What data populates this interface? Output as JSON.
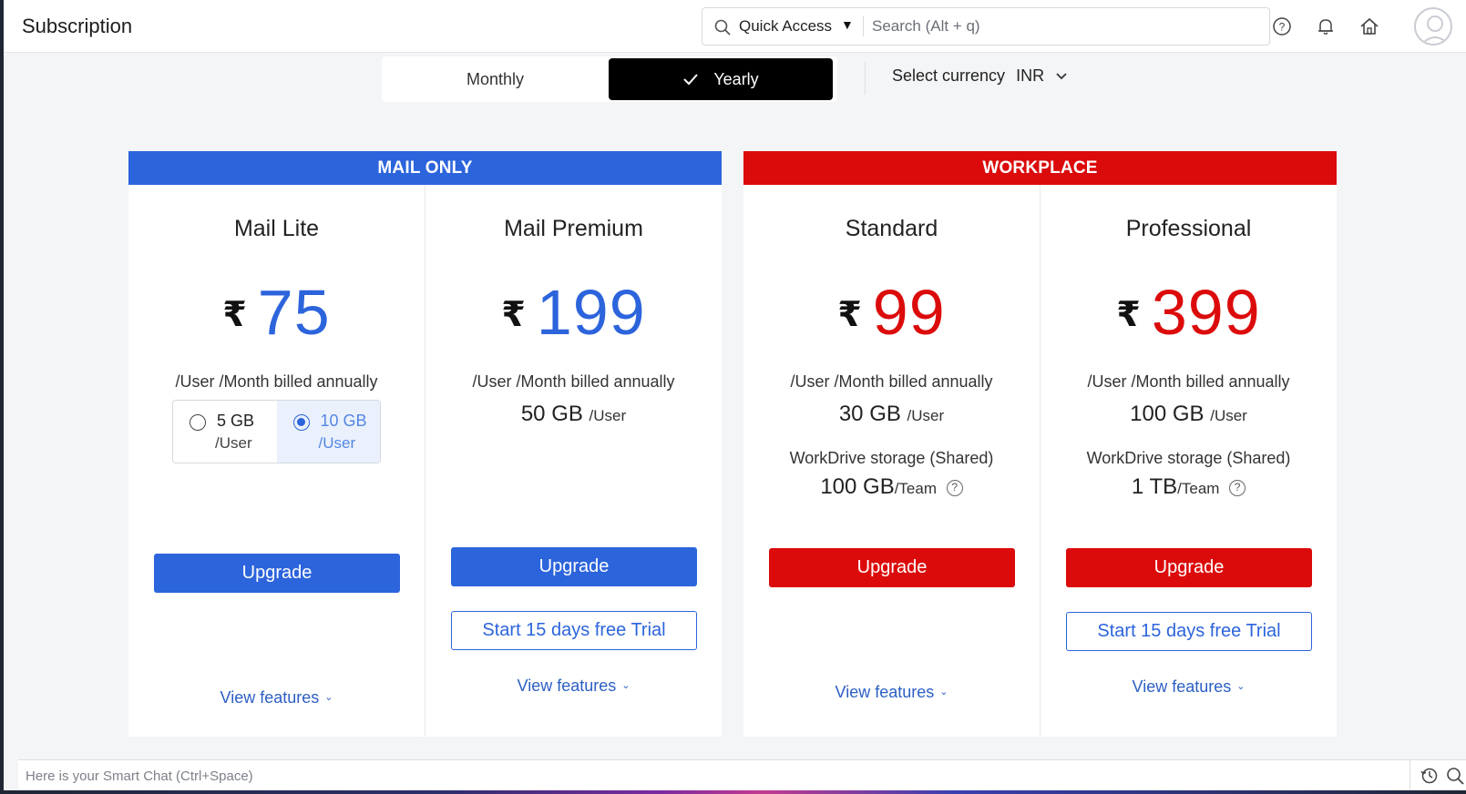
{
  "header": {
    "title": "Subscription",
    "quick_access_label": "Quick Access",
    "quick_access_caret": "▼",
    "search_placeholder": "Search (Alt + q)"
  },
  "billing": {
    "monthly_label": "Monthly",
    "yearly_label": "Yearly",
    "selected": "Yearly",
    "currency_label": "Select currency",
    "currency_value": "INR"
  },
  "groups": {
    "mail": {
      "banner": "MAIL ONLY",
      "color": "#2c64dc",
      "plans": {
        "lite": {
          "name": "Mail Lite",
          "currency_symbol": "₹",
          "price": "75",
          "billed": "/User /Month billed annually",
          "storage_options": [
            {
              "size": "5 GB",
              "per": "/User",
              "selected": false
            },
            {
              "size": "10 GB",
              "per": "/User",
              "selected": true
            }
          ],
          "upgrade_label": "Upgrade",
          "view_features_label": "View features"
        },
        "premium": {
          "name": "Mail Premium",
          "currency_symbol": "₹",
          "price": "199",
          "billed": "/User /Month billed annually",
          "storage": "50 GB",
          "storage_unit": "/User",
          "upgrade_label": "Upgrade",
          "trial_label": "Start 15 days free Trial",
          "view_features_label": "View features"
        }
      }
    },
    "workplace": {
      "banner": "WORKPLACE",
      "color": "#dc0b0b",
      "plans": {
        "standard": {
          "name": "Standard",
          "currency_symbol": "₹",
          "price": "99",
          "billed": "/User /Month billed annually",
          "storage": "30 GB",
          "storage_unit": "/User",
          "workdrive_label": "WorkDrive storage (Shared)",
          "workdrive_value": "100 GB",
          "workdrive_unit": "/Team",
          "upgrade_label": "Upgrade",
          "view_features_label": "View features"
        },
        "professional": {
          "name": "Professional",
          "currency_symbol": "₹",
          "price": "399",
          "billed": "/User /Month billed annually",
          "storage": "100 GB",
          "storage_unit": "/User",
          "workdrive_label": "WorkDrive storage (Shared)",
          "workdrive_value": "1 TB",
          "workdrive_unit": "/Team",
          "upgrade_label": "Upgrade",
          "trial_label": "Start 15 days free Trial",
          "view_features_label": "View features"
        }
      }
    }
  },
  "chat": {
    "placeholder": "Here is your Smart Chat (Ctrl+Space)"
  },
  "icons": {
    "help": "?",
    "check": "✓",
    "chevron": "⌄"
  }
}
